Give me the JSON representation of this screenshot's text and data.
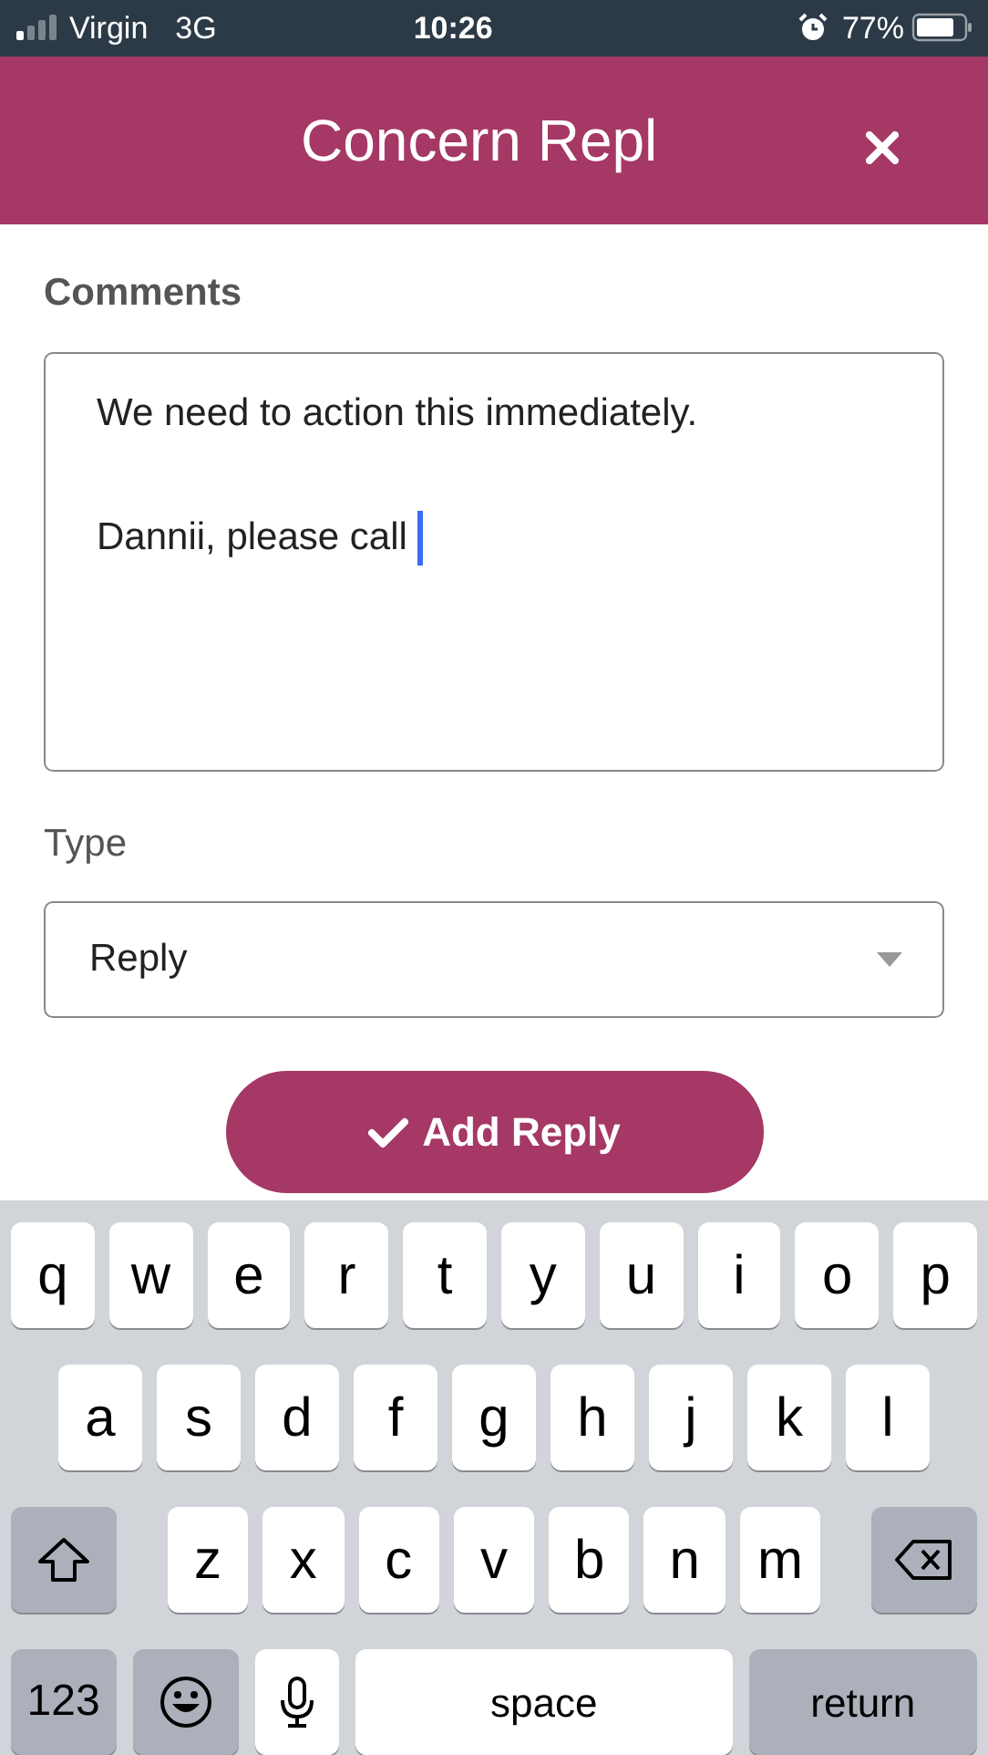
{
  "status_bar": {
    "carrier": "Virgin",
    "network": "3G",
    "time": "10:26",
    "battery": "77%"
  },
  "header": {
    "title": "Concern Repl"
  },
  "form": {
    "comments_label": "Comments",
    "comments_paragraphs": [
      "We need to action this immediately.",
      "Dannii, please call"
    ],
    "type_label": "Type",
    "type_value": "Reply",
    "submit": "Add Reply"
  },
  "keyboard": {
    "rows": [
      {
        "keys": [
          {
            "kind": "letter",
            "label": "q"
          },
          {
            "kind": "letter",
            "label": "w"
          },
          {
            "kind": "letter",
            "label": "e"
          },
          {
            "kind": "letter",
            "label": "r"
          },
          {
            "kind": "letter",
            "label": "t"
          },
          {
            "kind": "letter",
            "label": "y"
          },
          {
            "kind": "letter",
            "label": "u"
          },
          {
            "kind": "letter",
            "label": "i"
          },
          {
            "kind": "letter",
            "label": "o"
          },
          {
            "kind": "letter",
            "label": "p"
          }
        ]
      },
      {
        "keys": [
          {
            "kind": "letter",
            "label": "a"
          },
          {
            "kind": "letter",
            "label": "s"
          },
          {
            "kind": "letter",
            "label": "d"
          },
          {
            "kind": "letter",
            "label": "f"
          },
          {
            "kind": "letter",
            "label": "g"
          },
          {
            "kind": "letter",
            "label": "h"
          },
          {
            "kind": "letter",
            "label": "j"
          },
          {
            "kind": "letter",
            "label": "k"
          },
          {
            "kind": "letter",
            "label": "l"
          }
        ]
      },
      {
        "keys": [
          {
            "kind": "shift"
          },
          {
            "kind": "letter",
            "label": "z"
          },
          {
            "kind": "letter",
            "label": "x"
          },
          {
            "kind": "letter",
            "label": "c"
          },
          {
            "kind": "letter",
            "label": "v"
          },
          {
            "kind": "letter",
            "label": "b"
          },
          {
            "kind": "letter",
            "label": "n"
          },
          {
            "kind": "letter",
            "label": "m"
          },
          {
            "kind": "delete"
          }
        ]
      },
      {
        "keys": [
          {
            "kind": "numbers",
            "label": "123"
          },
          {
            "kind": "emoji"
          },
          {
            "kind": "mic"
          },
          {
            "kind": "space",
            "label": "space"
          },
          {
            "kind": "return",
            "label": "return"
          }
        ]
      }
    ]
  }
}
